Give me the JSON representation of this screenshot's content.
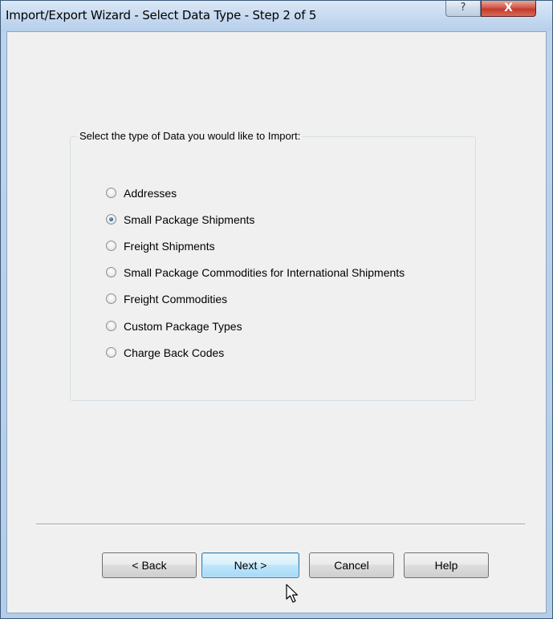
{
  "window": {
    "title": "Import/Export Wizard - Select Data Type - Step 2 of 5",
    "help_glyph": "?",
    "close_glyph": "X"
  },
  "group": {
    "legend": "Select the type of Data you would like to Import:",
    "selected": "Small Package Shipments",
    "options": [
      {
        "label": "Addresses",
        "checked": false
      },
      {
        "label": "Small Package Shipments",
        "checked": true
      },
      {
        "label": "Freight Shipments",
        "checked": false
      },
      {
        "label": "Small Package Commodities for International Shipments",
        "checked": false
      },
      {
        "label": "Freight Commodities",
        "checked": false
      },
      {
        "label": "Custom Package Types",
        "checked": false
      },
      {
        "label": "Charge Back Codes",
        "checked": false
      }
    ]
  },
  "buttons": {
    "back": "< Back",
    "next": "Next >",
    "cancel": "Cancel",
    "help": "Help"
  },
  "icons": {
    "help": "help-icon",
    "close": "close-icon",
    "cursor": "mouse-pointer-icon"
  },
  "colors": {
    "title_bar": "#c9dcf1",
    "close_button": "#c23a2c",
    "client_background": "#f0f0f0",
    "radio_selected": "#1d5a9c"
  }
}
